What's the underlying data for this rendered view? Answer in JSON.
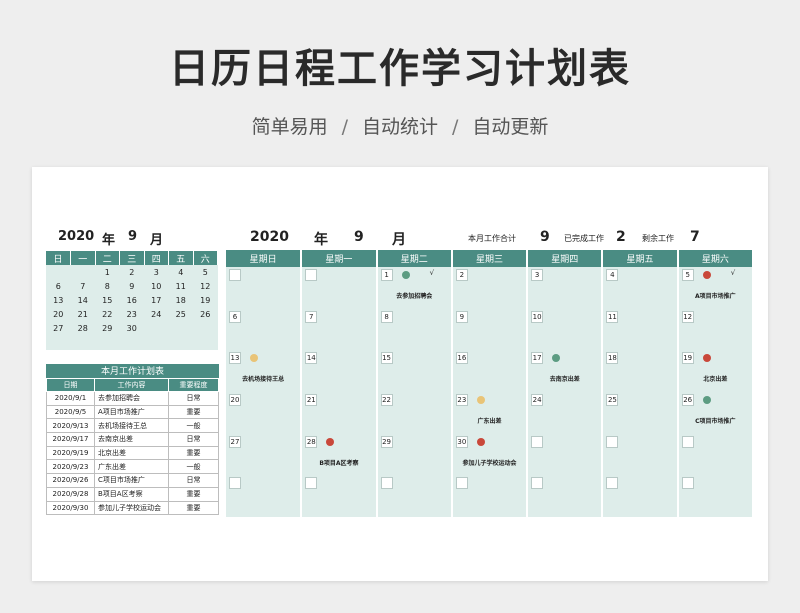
{
  "hero": {
    "title": "日历日程工作学习计划表",
    "sub_1": "简单易用",
    "sub_sep": "/",
    "sub_2": "自动统计",
    "sub_3": "自动更新"
  },
  "colors": {
    "header_teal": "#4a8c83",
    "cell_bg": "#deedea",
    "dot_green": "#5c9c82",
    "dot_red": "#c9483a",
    "dot_yellow": "#e9c477"
  },
  "mini_calendar": {
    "year": "2020",
    "year_label": "年",
    "month": "9",
    "month_label": "月",
    "weekdays": [
      "日",
      "一",
      "二",
      "三",
      "四",
      "五",
      "六"
    ],
    "weeks": [
      [
        "",
        "",
        "1",
        "2",
        "3",
        "4",
        "5"
      ],
      [
        "6",
        "7",
        "8",
        "9",
        "10",
        "11",
        "12"
      ],
      [
        "13",
        "14",
        "15",
        "16",
        "17",
        "18",
        "19"
      ],
      [
        "20",
        "21",
        "22",
        "23",
        "24",
        "25",
        "26"
      ],
      [
        "27",
        "28",
        "29",
        "30",
        "",
        "",
        ""
      ],
      [
        "",
        "",
        "",
        "",
        "",
        "",
        ""
      ]
    ]
  },
  "task_list": {
    "title": "本月工作计划表",
    "headers": [
      "日期",
      "工作内容",
      "重要程度"
    ],
    "rows": [
      [
        "2020/9/1",
        "去参加招聘会",
        "日常"
      ],
      [
        "2020/9/5",
        "A项目市场推广",
        "重要"
      ],
      [
        "2020/9/13",
        "去机场接待王总",
        "一般"
      ],
      [
        "2020/9/17",
        "去南京出差",
        "日常"
      ],
      [
        "2020/9/19",
        "北京出差",
        "重要"
      ],
      [
        "2020/9/23",
        "广东出差",
        "一般"
      ],
      [
        "2020/9/26",
        "C项目市场推广",
        "日常"
      ],
      [
        "2020/9/28",
        "B项目A区考察",
        "重要"
      ],
      [
        "2020/9/30",
        "参加儿子学校运动会",
        "重要"
      ]
    ]
  },
  "main_header": {
    "year": "2020",
    "year_label": "年",
    "month": "9",
    "month_label": "月",
    "total_label": "本月工作合计",
    "total": "9",
    "done_label": "已完成工作",
    "done": "2",
    "left_label": "剩余工作",
    "left": "7"
  },
  "calendar": {
    "weekdays": [
      "星期日",
      "星期一",
      "星期二",
      "星期三",
      "星期四",
      "星期五",
      "星期六"
    ],
    "weeks": [
      [
        {
          "day": ""
        },
        {
          "day": ""
        },
        {
          "day": "1",
          "dot": "green",
          "check": "√",
          "task": "去参加招聘会"
        },
        {
          "day": "2"
        },
        {
          "day": "3"
        },
        {
          "day": "4"
        },
        {
          "day": "5",
          "dot": "red",
          "check": "√",
          "task": "A项目市场推广"
        }
      ],
      [
        {
          "day": "6"
        },
        {
          "day": "7"
        },
        {
          "day": "8"
        },
        {
          "day": "9"
        },
        {
          "day": "10"
        },
        {
          "day": "11"
        },
        {
          "day": "12"
        }
      ],
      [
        {
          "day": "13",
          "dot": "yellow",
          "task": "去机场接待王总"
        },
        {
          "day": "14"
        },
        {
          "day": "15"
        },
        {
          "day": "16"
        },
        {
          "day": "17",
          "dot": "green",
          "task": "去南京出差"
        },
        {
          "day": "18"
        },
        {
          "day": "19",
          "dot": "red",
          "task": "北京出差"
        }
      ],
      [
        {
          "day": "20"
        },
        {
          "day": "21"
        },
        {
          "day": "22"
        },
        {
          "day": "23",
          "dot": "yellow",
          "task": "广东出差"
        },
        {
          "day": "24"
        },
        {
          "day": "25"
        },
        {
          "day": "26",
          "dot": "green",
          "task": "C项目市场推广"
        }
      ],
      [
        {
          "day": "27"
        },
        {
          "day": "28",
          "dot": "red",
          "task": "B项目A区考察"
        },
        {
          "day": "29"
        },
        {
          "day": "30",
          "dot": "red",
          "task": "参加儿子学校运动会"
        },
        {
          "day": ""
        },
        {
          "day": ""
        },
        {
          "day": ""
        }
      ],
      [
        {
          "day": ""
        },
        {
          "day": ""
        },
        {
          "day": ""
        },
        {
          "day": ""
        },
        {
          "day": ""
        },
        {
          "day": ""
        },
        {
          "day": ""
        }
      ]
    ]
  }
}
